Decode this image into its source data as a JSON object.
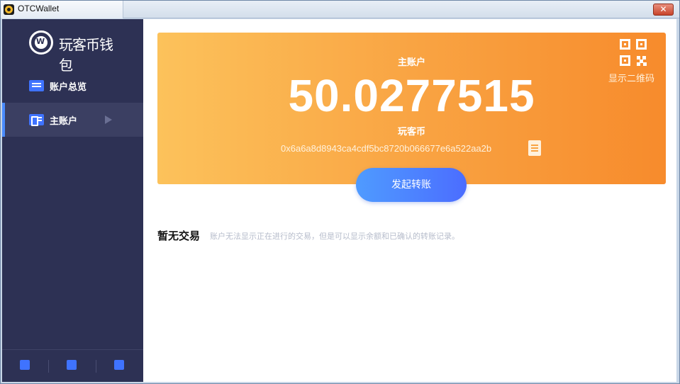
{
  "window": {
    "title": "OTCWallet",
    "close_label": "✕"
  },
  "sidebar": {
    "logo_text": "玩客币钱包",
    "logo_mark": "W",
    "items": [
      {
        "label": "账户总览",
        "icon": "list-icon"
      },
      {
        "label": "主账户",
        "icon": "account-card-icon",
        "active": true
      }
    ],
    "footer_icons": [
      "add-wallet-icon",
      "import-wallet-icon",
      "restore-wallet-icon"
    ]
  },
  "account": {
    "label": "主账户",
    "balance": "50.0277515",
    "coin": "玩客币",
    "address": "0x6a6a8d8943ca4cdf5bc8720b066677e6a522aa2b",
    "qr_label": "显示二维码",
    "transfer_label": "发起转账"
  },
  "transactions": {
    "empty_title": "暂无交易",
    "empty_desc": "账户无法显示正在进行的交易，但是可以显示余额和已确认的转账记录。"
  },
  "colors": {
    "sidebar": "#2d3154",
    "accent": "#3f73ff",
    "banner_start": "#fcc25b",
    "banner_end": "#f78b2c"
  }
}
